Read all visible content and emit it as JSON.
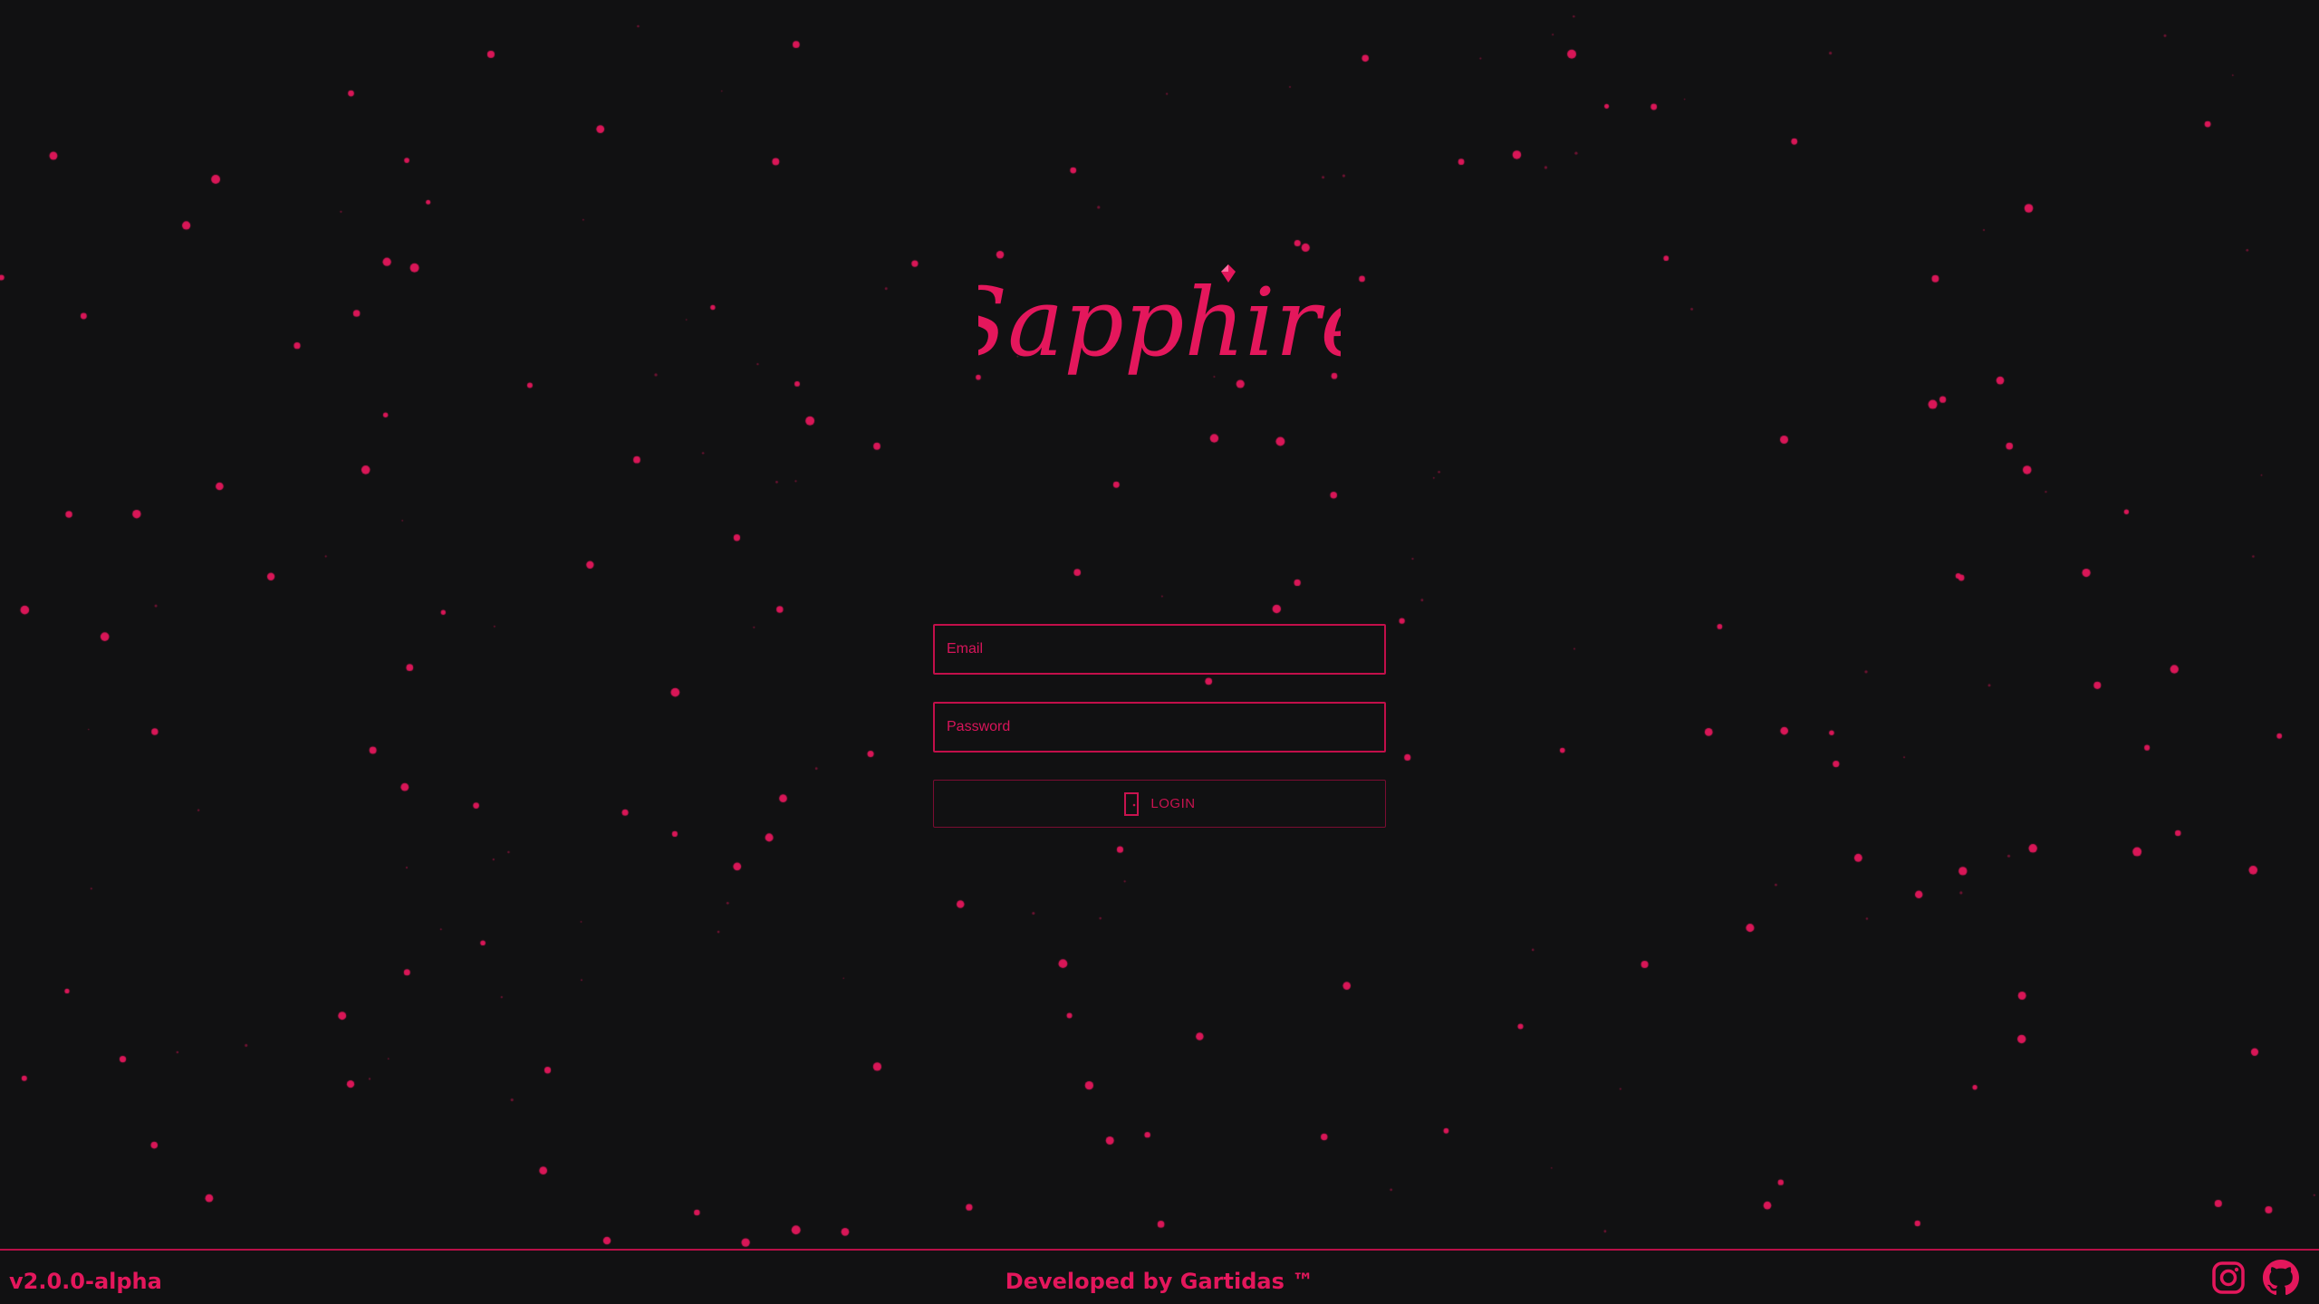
{
  "app": {
    "name": "Sapphire",
    "accent_color": "#e4175c",
    "background_color": "#111112"
  },
  "login_form": {
    "email_placeholder": "Email",
    "password_placeholder": "Password",
    "login_label": "LOGIN",
    "login_icon": "door-icon"
  },
  "footer": {
    "version": "v2.0.0-alpha",
    "credits": "Developed by Gartidas ™",
    "social_icons": [
      "instagram-icon",
      "github-icon"
    ]
  }
}
